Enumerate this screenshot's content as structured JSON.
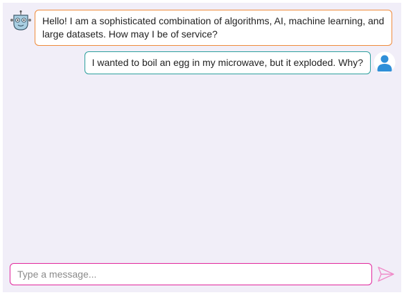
{
  "messages": [
    {
      "sender": "bot",
      "avatar_icon": "robot-icon",
      "text": "Hello! I am a sophisticated combination of algorithms, AI, machine learning, and large datasets. How may I be of service?",
      "border_color": "#ef8a3a"
    },
    {
      "sender": "user",
      "avatar_icon": "user-icon",
      "text": "I wanted to boil an egg in my microwave, but it exploded. Why?",
      "border_color": "#2a9e9c"
    }
  ],
  "composer": {
    "placeholder": "Type a message...",
    "value": "",
    "border_color": "#e0249b",
    "send_icon": "send-icon"
  },
  "colors": {
    "background": "#f1eef8",
    "user_avatar": "#2f8fd8",
    "send_icon": "#f08ac8"
  }
}
